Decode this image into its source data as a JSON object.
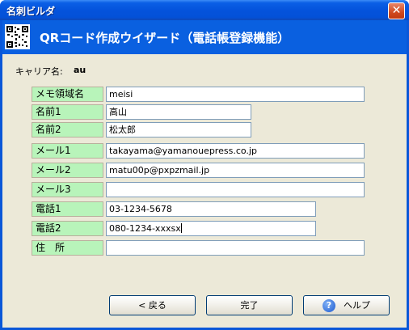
{
  "window": {
    "title": "名刺ビルダ",
    "close_label": "✕"
  },
  "banner": {
    "heading": "QRコード作成ウイザード（電話帳登録機能）"
  },
  "carrier": {
    "label": "キャリア名:",
    "value": "au"
  },
  "fields": [
    {
      "label": "メモ領域名",
      "value": "meisi"
    },
    {
      "label": "名前1",
      "value": "高山"
    },
    {
      "label": "名前2",
      "value": "松太郎"
    },
    {
      "label": "メール1",
      "value": "takayama@yamanouepress.co.jp"
    },
    {
      "label": "メール2",
      "value": "matu00p@pxpzmail.jp"
    },
    {
      "label": "メール3",
      "value": ""
    },
    {
      "label": "電話1",
      "value": "03-1234-5678"
    },
    {
      "label": "電話2",
      "value": "080-1234-xxxsx"
    },
    {
      "label": "住　所",
      "value": ""
    }
  ],
  "buttons": {
    "back": "< 戻る",
    "finish": "完了",
    "help": "ヘルプ"
  },
  "colors": {
    "title_bar": "#0453dc",
    "banner": "#0a60e0",
    "label_bg": "#b8f4ba",
    "dialog_bg": "#ece9d8"
  }
}
